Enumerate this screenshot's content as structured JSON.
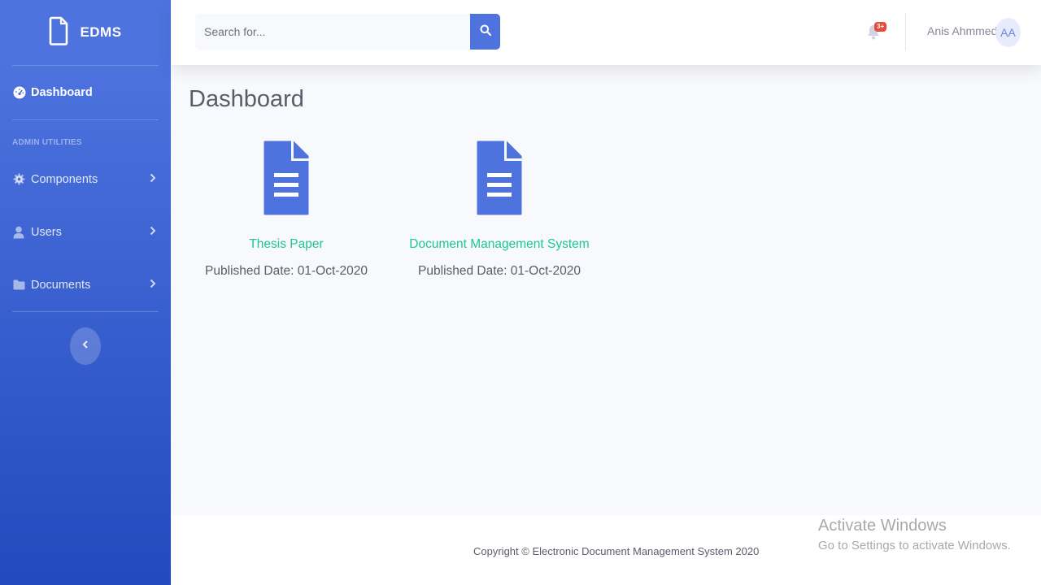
{
  "brand": {
    "name": "EDMS",
    "icon": "file-icon"
  },
  "sidebar": {
    "dashboard": {
      "label": "Dashboard",
      "icon": "tachometer-icon"
    },
    "heading": "ADMIN UTILITIES",
    "items": [
      {
        "label": "Components",
        "icon": "cog-icon"
      },
      {
        "label": "Users",
        "icon": "user-icon"
      },
      {
        "label": "Documents",
        "icon": "folder-icon"
      }
    ]
  },
  "topbar": {
    "search_placeholder": "Search for...",
    "alerts_badge": "3+",
    "user_name": "Anis Ahmmed",
    "avatar_initials": "AA"
  },
  "main": {
    "title": "Dashboard",
    "documents": [
      {
        "title": "Thesis Paper",
        "date": "Published Date: 01-Oct-2020"
      },
      {
        "title": "Document Management System",
        "date": "Published Date: 01-Oct-2020"
      }
    ]
  },
  "footer": {
    "copyright": "Copyright © Electronic Document Management System 2020"
  },
  "watermark": {
    "title": "Activate Windows",
    "subtitle": "Go to Settings to activate Windows."
  },
  "colors": {
    "primary": "#4e73df",
    "primary_dark": "#224abe",
    "success": "#1cc88a",
    "danger": "#e74a3b",
    "text": "#5a5c69"
  }
}
